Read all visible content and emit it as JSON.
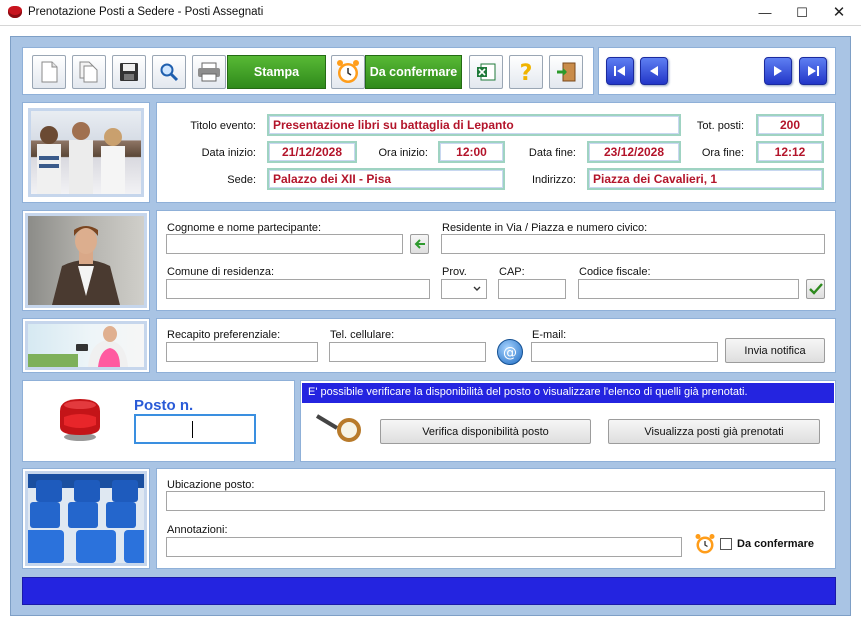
{
  "window": {
    "title": "Prenotazione Posti a Sedere - Posti Assegnati"
  },
  "toolbar": {
    "stampa_label": "Stampa",
    "da_confermare_label": "Da confermare",
    "icons": [
      "new-doc-icon",
      "copy-doc-icon",
      "save-icon",
      "search-icon",
      "printer-icon",
      "alarm-clock-icon",
      "excel-icon",
      "help-icon",
      "exit-icon"
    ],
    "accent": "#3a9a22"
  },
  "navigation": [
    "first-record-icon",
    "previous-record-icon",
    "next-record-icon",
    "last-record-icon"
  ],
  "event": {
    "title_label": "Titolo evento:",
    "title_value": "Presentazione libri su battaglia di Lepanto",
    "tot_label": "Tot. posti:",
    "tot_value": "200",
    "start_date_label": "Data inizio:",
    "start_date_value": "21/12/2028",
    "start_time_label": "Ora inizio:",
    "start_time_value": "12:00",
    "end_date_label": "Data fine:",
    "end_date_value": "23/12/2028",
    "end_time_label": "Ora fine:",
    "end_time_value": "12:12",
    "venue_label": "Sede:",
    "venue_value": "Palazzo dei XII - Pisa",
    "address_label": "Indirizzo:",
    "address_value": "Piazza dei Cavalieri, 1"
  },
  "participant": {
    "name_label": "Cognome e nome partecipante:",
    "name_value": "",
    "residence_label": "Residente in Via / Piazza e numero civico:",
    "residence_value": "",
    "comune_label": "Comune di residenza:",
    "comune_value": "",
    "prov_label": "Prov.",
    "prov_value": "",
    "cap_label": "CAP:",
    "cap_value": "",
    "cf_label": "Codice fiscale:",
    "cf_value": ""
  },
  "contact": {
    "recapito_label": "Recapito preferenziale:",
    "recapito_value": "",
    "cell_label": "Tel. cellulare:",
    "cell_value": "",
    "email_label": "E-mail:",
    "email_value": "",
    "notify_button": "Invia notifica"
  },
  "seat": {
    "label": "Posto n.",
    "value": "",
    "info_text": "E' possibile verificare la disponibilità del posto o visualizzare l'elenco di quelli già prenotati.",
    "verify_button": "Verifica disponibilità posto",
    "list_button": "Visualizza posti già prenotati",
    "label_color": "#2a5bd7"
  },
  "location": {
    "ubicazione_label": "Ubicazione posto:",
    "ubicazione_value": "",
    "annotazioni_label": "Annotazioni:",
    "annotazioni_value": "",
    "da_confermare_label": "Da confermare",
    "da_confermare_checked": false
  },
  "colors": {
    "banner": "#2424e0",
    "field_text": "#b3142a",
    "frame": "#a9c4e4"
  }
}
